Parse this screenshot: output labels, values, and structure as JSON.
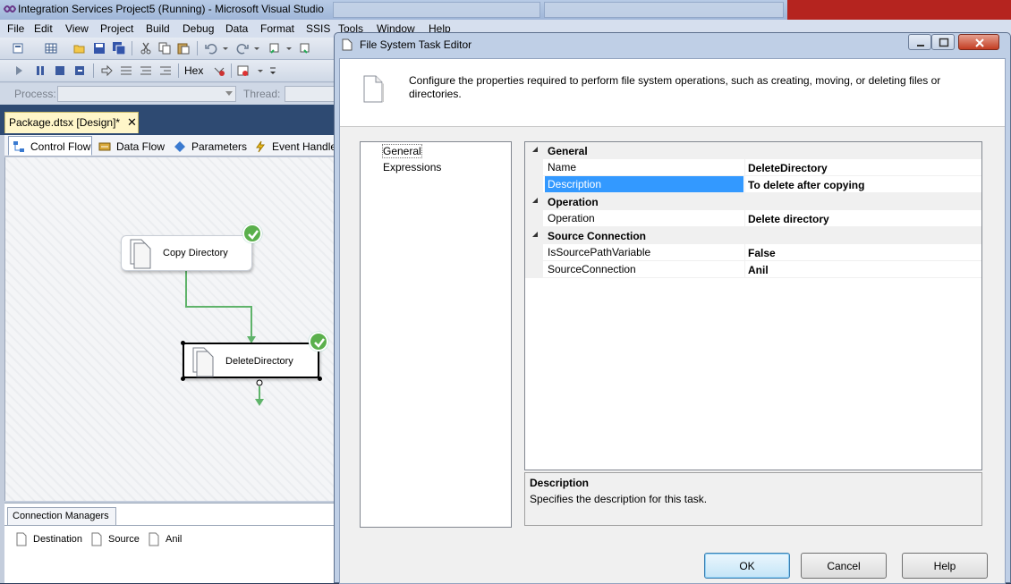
{
  "vs": {
    "title": "Integration Services Project5 (Running) - Microsoft Visual Studio",
    "menu": [
      "File",
      "Edit",
      "View",
      "Project",
      "Build",
      "Debug",
      "Data",
      "Format",
      "SSIS",
      "Tools",
      "Window",
      "Help"
    ],
    "toolbar2": {
      "hex_label": "Hex"
    },
    "process_label": "Process:",
    "thread_label": "Thread:",
    "document_tab": {
      "label": "Package.dtsx [Design]*",
      "close": "✕"
    },
    "designer_tabs": [
      {
        "label": "Control Flow",
        "icon": "control-flow-icon"
      },
      {
        "label": "Data Flow",
        "icon": "data-flow-icon"
      },
      {
        "label": "Parameters",
        "icon": "parameters-icon"
      },
      {
        "label": "Event Handlers",
        "icon": "event-handlers-icon"
      }
    ],
    "tasks": [
      {
        "label": "Copy Directory",
        "status": "success"
      },
      {
        "label": "DeleteDirectory",
        "status": "success"
      }
    ],
    "connection_managers": {
      "tab_label": "Connection Managers",
      "items": [
        "Destination",
        "Source",
        "Anil"
      ]
    }
  },
  "dialog": {
    "title": "File System Task Editor",
    "header_text": "Configure the properties required to perform file system operations, such as creating, moving, or deleting files or directories.",
    "nav_items": [
      "General",
      "Expressions"
    ],
    "selected_nav": "General",
    "property_grid": {
      "categories": [
        {
          "name": "General",
          "rows": [
            {
              "name": "Name",
              "value": "DeleteDirectory"
            },
            {
              "name": "Description",
              "value": "To delete after copying"
            }
          ]
        },
        {
          "name": "Operation",
          "rows": [
            {
              "name": "Operation",
              "value": "Delete directory"
            }
          ]
        },
        {
          "name": "Source Connection",
          "rows": [
            {
              "name": "IsSourcePathVariable",
              "value": "False"
            },
            {
              "name": "SourceConnection",
              "value": "Anil"
            }
          ]
        }
      ],
      "selected_property": "Description"
    },
    "description_pane": {
      "title": "Description",
      "text": "Specifies the description for this task."
    },
    "buttons": {
      "ok": "OK",
      "cancel": "Cancel",
      "help": "Help"
    }
  },
  "colors": {
    "selection": "#3399ff",
    "success": "#5ab04c",
    "titlebar_close": "#c33d22"
  }
}
